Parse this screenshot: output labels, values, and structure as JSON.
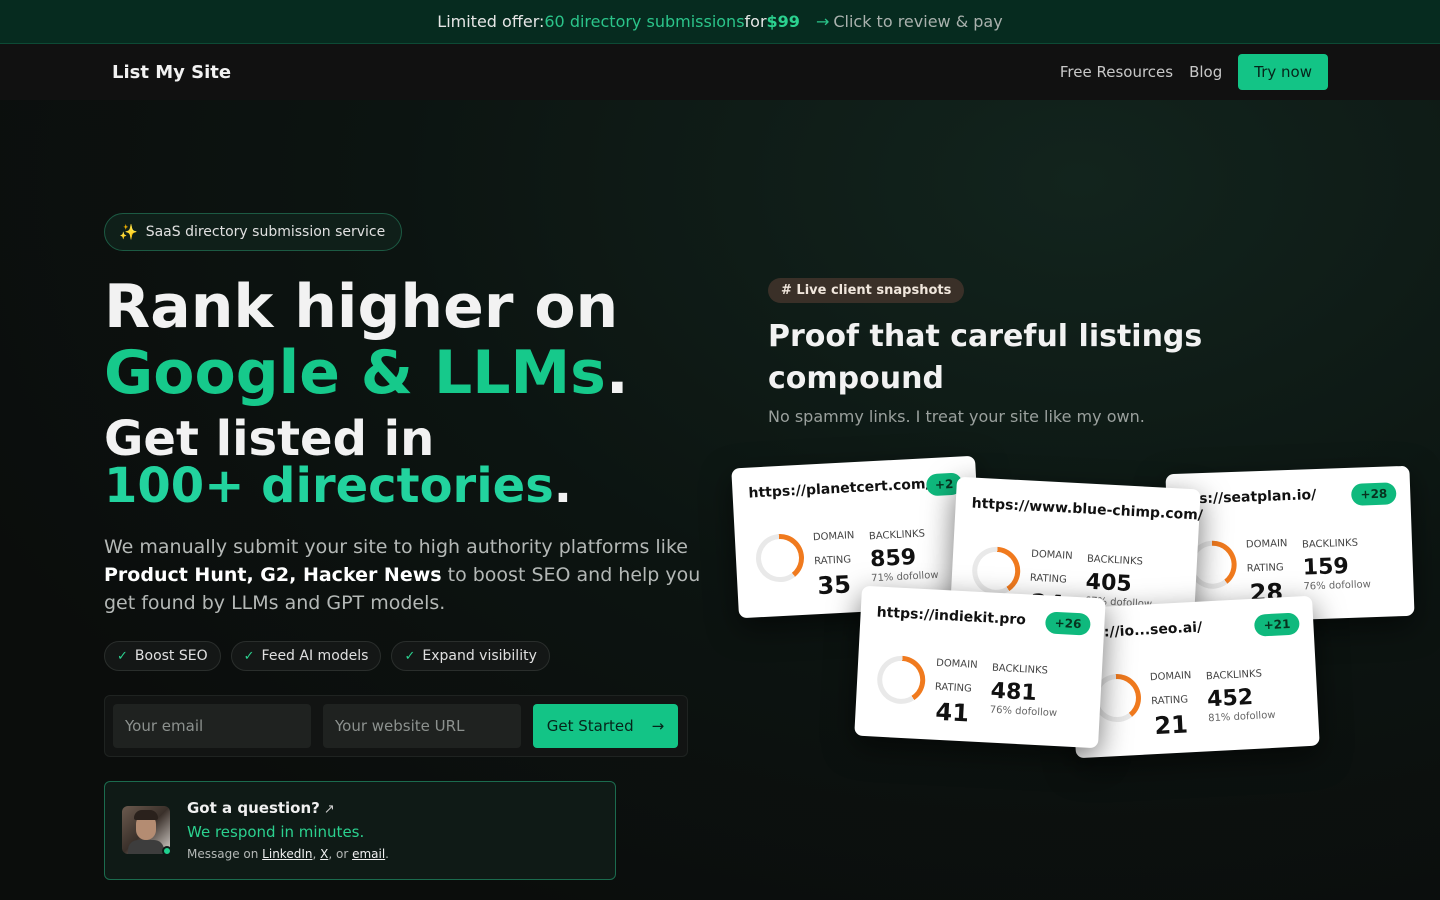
{
  "banner": {
    "prefix": "Limited offer: ",
    "highlight": "60 directory submissions",
    "mid": " for ",
    "price": "$99",
    "arrow": "→",
    "cta": "Click to review & pay"
  },
  "nav": {
    "brand": "List My Site",
    "links": [
      "Free Resources",
      "Blog"
    ],
    "try_label": "Try now"
  },
  "hero": {
    "pill": "SaaS directory submission service",
    "line1": "Rank higher on",
    "line2": "Google & LLMs",
    "line3": "Get listed in",
    "line4": "100+ directories",
    "dot": ".",
    "lead_start": "We manually submit your site to high authority platforms like ",
    "lead_bold": "Product Hunt, G2, Hacker News",
    "lead_end": " to boost SEO and help you get found by LLMs and GPT models.",
    "chips": [
      "Boost SEO",
      "Feed AI models",
      "Expand visibility"
    ],
    "form": {
      "email_placeholder": "Your email",
      "url_placeholder": "Your website URL",
      "submit_label": "Get Started",
      "submit_arrow": "→"
    },
    "question": {
      "title": "Got a question?",
      "title_icon": "↗",
      "subtitle": "We respond in minutes.",
      "msg_prefix": "Message on ",
      "link_linkedin": "LinkedIn",
      "sep1": ", ",
      "link_x": "X",
      "sep2": ", or ",
      "link_email": "email",
      "msg_suffix": "."
    }
  },
  "proof": {
    "badge": "# Live client snapshots",
    "title": "Proof that careful listings compound",
    "subtitle": "No spammy links. I treat your site like my own.",
    "domain_label": "DOMAIN",
    "rating_label": "RATING",
    "backlinks_label": "BACKLINKS",
    "cards": [
      {
        "url": "https://planetcert.com/",
        "delta": "+2",
        "rating": "35",
        "backlinks": "859",
        "dofollow": "71% dofollow"
      },
      {
        "url": "https://www.blue-chimp.com/",
        "delta": "",
        "rating": "24",
        "backlinks": "405",
        "dofollow": "67% dofollow"
      },
      {
        "url": "tps://seatplan.io/",
        "delta": "+28",
        "rating": "28",
        "backlinks": "159",
        "dofollow": "76% dofollow"
      },
      {
        "url": "ps://io...seo.ai/",
        "delta": "+21",
        "rating": "21",
        "backlinks": "452",
        "dofollow": "81% dofollow"
      },
      {
        "url": "https://indiekit.pro",
        "delta": "+26",
        "rating": "41",
        "backlinks": "481",
        "dofollow": "76% dofollow"
      }
    ]
  },
  "colors": {
    "accent": "#13c486",
    "banner_bg": "#062b1f",
    "ring_orange": "#f07a1e"
  }
}
